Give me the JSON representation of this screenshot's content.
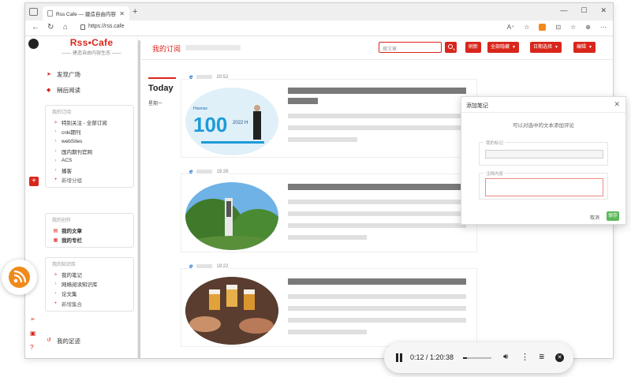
{
  "browser": {
    "tab_title": "Rss Cafe — 建造自由内容生态",
    "url": "https://rss.cafe",
    "controls": {
      "minimize": "—",
      "maximize": "☐",
      "close": "✕",
      "new_tab": "+"
    },
    "toolbar_icons": [
      "A⁺",
      "☆",
      "rss-icon",
      "⊡",
      "☆",
      "⊕",
      "⋯"
    ]
  },
  "sidebar": {
    "brand_title": "Rss•Cafe",
    "brand_subtitle": "—— 建造自由内容生态 ——",
    "nav": [
      {
        "label": "发现广场",
        "icon": "discover-icon"
      },
      {
        "label": "稍后阅读",
        "icon": "bookmark-icon"
      }
    ],
    "subscriptions": {
      "title": "我的订阅",
      "items": [
        {
          "label": "特别关注 - 全部订阅",
          "kind": "star"
        },
        {
          "label": "cnki期刊",
          "kind": "folder"
        },
        {
          "label": "webSites",
          "kind": "folder"
        },
        {
          "label": "国内期刊官网",
          "kind": "folder"
        },
        {
          "label": "ACS",
          "kind": "folder"
        },
        {
          "label": "播客",
          "kind": "folder"
        },
        {
          "label": "新增分组",
          "kind": "add"
        }
      ]
    },
    "creations": {
      "title": "我的创作",
      "items": [
        {
          "label": "我的文章"
        },
        {
          "label": "我的专栏"
        }
      ]
    },
    "knowledge": {
      "title": "我的知识库",
      "items": [
        {
          "label": "我的笔记",
          "kind": "star"
        },
        {
          "label": "网络阅读知识库",
          "kind": "folder"
        },
        {
          "label": "论文集",
          "kind": "folder"
        },
        {
          "label": "新增集合",
          "kind": "add"
        }
      ]
    },
    "footprint": "我的足迹"
  },
  "main": {
    "page_title": "我的订阅",
    "search_placeholder": "搜文章",
    "buttons": {
      "refresh": "刷新",
      "read_all": "全部隐藏",
      "date_filter": "日期选择",
      "edit": "编辑"
    },
    "today": "Today",
    "weekday": "星期一",
    "cards": [
      {
        "time": "20:52",
        "image": "hisense-event-photo"
      },
      {
        "time": "19:26",
        "image": "campus-tower-photo"
      },
      {
        "time": "19:22",
        "image": "beer-toast-photo"
      }
    ]
  },
  "dialog": {
    "title": "添加笔记",
    "hint": "可以对选中的文本添加评论",
    "tag_legend": "我的标记",
    "note_legend": "注释内容",
    "cancel": "取消",
    "save": "保存"
  },
  "media": {
    "time": "0:12 / 1:20:38",
    "progress": 0.15
  },
  "colors": {
    "accent": "#d9261c",
    "rss_orange": "#f08a1c",
    "save_green": "#5cb85c"
  }
}
